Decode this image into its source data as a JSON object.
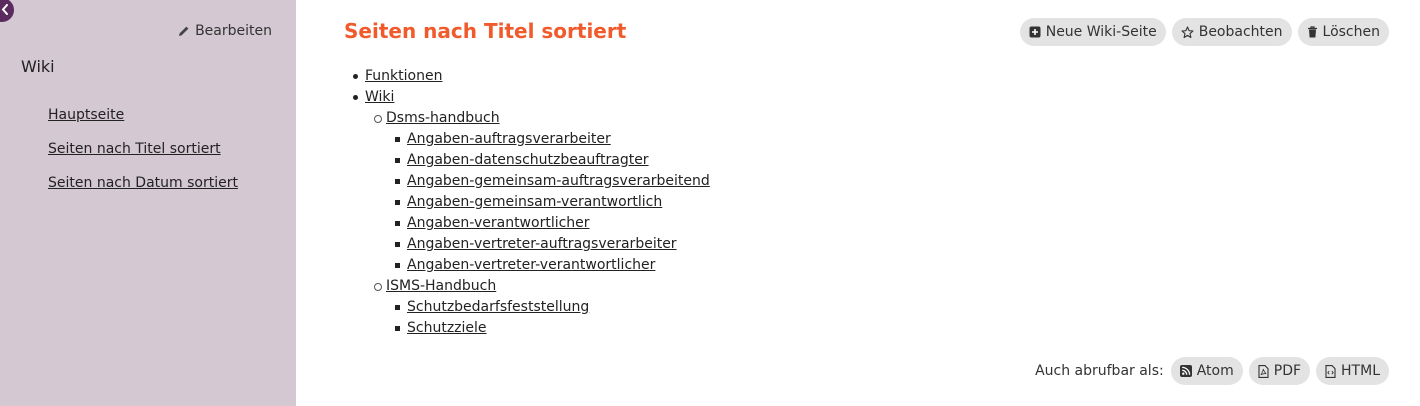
{
  "sidebar": {
    "edit_label": "Bearbeiten",
    "title": "Wiki",
    "items": [
      {
        "label": "Hauptseite"
      },
      {
        "label": "Seiten nach Titel sortiert"
      },
      {
        "label": "Seiten nach Datum sortiert"
      }
    ]
  },
  "main": {
    "title": "Seiten nach Titel sortiert",
    "actions": {
      "new_page": "Neue Wiki-Seite",
      "watch": "Beobachten",
      "delete": "Löschen"
    },
    "tree": {
      "funktionen": "Funktionen",
      "wiki": "Wiki",
      "dsms": "Dsms-handbuch",
      "dsms_pages": [
        "Angaben-auftragsverarbeiter",
        "Angaben-datenschutzbeauftragter",
        "Angaben-gemeinsam-auftragsverarbeitend",
        "Angaben-gemeinsam-verantwortlich",
        "Angaben-verantwortlicher",
        "Angaben-vertreter-auftragsverarbeiter",
        "Angaben-vertreter-verantwortlicher"
      ],
      "isms": "ISMS-Handbuch",
      "isms_pages": [
        "Schutzbedarfsfeststellung",
        "Schutzziele"
      ]
    }
  },
  "footer": {
    "label": "Auch abrufbar als:",
    "formats": [
      "Atom",
      "PDF",
      "HTML"
    ]
  },
  "colors": {
    "sidebar_bg": "#d4c8d2",
    "title_accent": "#f15a2b",
    "collapse_button": "#5b2a5f",
    "pill_bg": "#e3e3e3"
  },
  "icons": {
    "collapse": "chevron-left-icon",
    "edit": "pencil-icon",
    "new_page": "plus-square-icon",
    "watch": "star-icon",
    "delete": "trash-icon",
    "atom": "rss-icon",
    "pdf": "pdf-file-icon",
    "html": "code-file-icon"
  }
}
